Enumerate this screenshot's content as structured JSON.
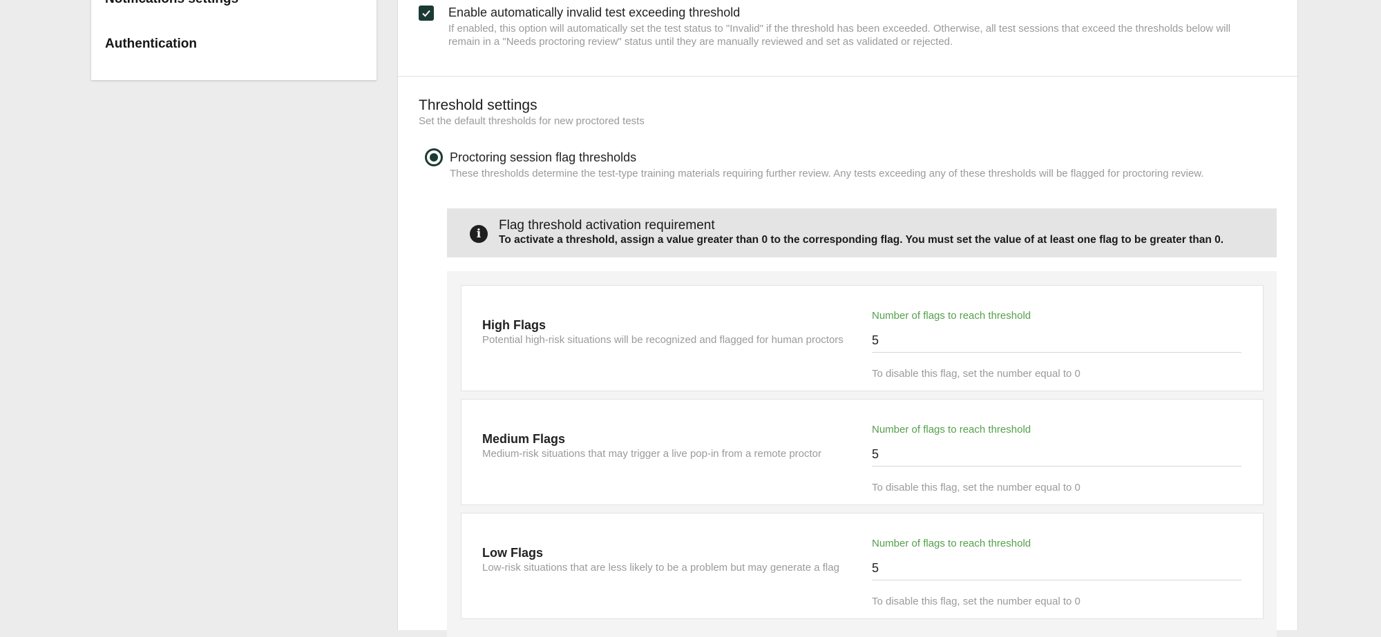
{
  "sidebar": {
    "items": [
      {
        "label": "Notifications settings"
      },
      {
        "label": "Authentication"
      }
    ]
  },
  "auto_invalid": {
    "checked": true,
    "title": "Enable automatically invalid test exceeding threshold",
    "description": "If enabled, this option will automatically set the test status to \"Invalid\" if the threshold has been exceeded. Otherwise, all test sessions that exceed the thresholds below will remain in a \"Needs proctoring review\" status until they are manually reviewed and set as validated or rejected."
  },
  "threshold_settings": {
    "title": "Threshold settings",
    "subtitle": "Set the default thresholds for new proctored tests",
    "option": {
      "selected": true,
      "title": "Proctoring session flag thresholds",
      "description": "These thresholds determine the test-type training materials requiring further review. Any tests exceeding any of these thresholds will be flagged for proctoring review."
    },
    "info": {
      "icon": "info-icon",
      "title": "Flag threshold activation requirement",
      "text": "To activate a threshold, assign a value greater than 0 to the corresponding flag. You must set the value of at least one flag to be greater than 0."
    },
    "flags": [
      {
        "name": "High Flags",
        "description": "Potential high-risk situations will be recognized and flagged for human proctors",
        "field_label": "Number of flags to reach threshold",
        "value": "5",
        "hint": "To disable this flag, set the number equal to 0"
      },
      {
        "name": "Medium Flags",
        "description": "Medium-risk situations that may trigger a live pop-in from a remote proctor",
        "field_label": "Number of flags to reach threshold",
        "value": "5",
        "hint": "To disable this flag, set the number equal to 0"
      },
      {
        "name": "Low Flags",
        "description": "Low-risk situations that are less likely to be a problem but may generate a flag",
        "field_label": "Number of flags to reach threshold",
        "value": "5",
        "hint": "To disable this flag, set the number equal to 0"
      }
    ]
  },
  "colors": {
    "accent_dark": "#1b3a33",
    "field_label_green": "#54a04a",
    "muted_text": "#9a9a9a",
    "info_bg": "#e3e4e3"
  }
}
